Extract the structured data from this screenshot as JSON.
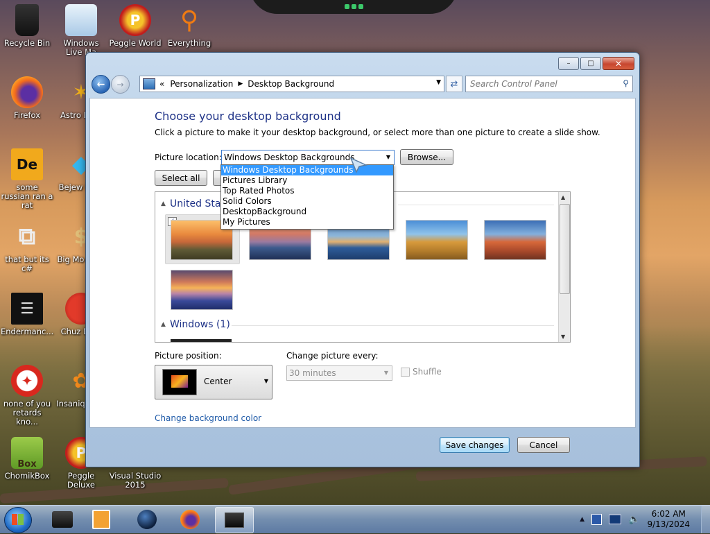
{
  "desktop": {
    "icons": [
      {
        "label": "Recycle Bin",
        "icon": "recycle-bin-icon"
      },
      {
        "label": "Windows Live Ma",
        "icon": "windows-live-mail-icon"
      },
      {
        "label": "Peggle World",
        "icon": "peggle-icon"
      },
      {
        "label": "Everything",
        "icon": "search-magnifier-icon"
      },
      {
        "label": "Firefox",
        "icon": "firefox-icon"
      },
      {
        "label": "Astro Delu",
        "icon": "astro-game-icon"
      },
      {
        "label": "some russian ran a rat",
        "icon": "de-app-icon"
      },
      {
        "label": "Bejew Delu",
        "icon": "gem-icon"
      },
      {
        "label": "that but its c#",
        "icon": "copy-windows-icon"
      },
      {
        "label": "Big Mo Delu",
        "icon": "money-bag-icon"
      },
      {
        "label": "Endermanc...",
        "icon": "console-icon"
      },
      {
        "label": "Chuz Delu",
        "icon": "chuzzle-icon"
      },
      {
        "label": "none of you retards kno...",
        "icon": "red-dino-icon"
      },
      {
        "label": "Insaniq Delu",
        "icon": "fish-icon"
      },
      {
        "label": "ChomikBox",
        "icon": "chomikbox-icon"
      },
      {
        "label": "Peggle Deluxe",
        "icon": "peggle-icon"
      },
      {
        "label": "Visual Studio 2015",
        "icon": "visual-studio-icon"
      }
    ]
  },
  "window": {
    "controls": {
      "minimize": "–",
      "maximize": "□",
      "close": "✕"
    },
    "nav": {
      "back": "←",
      "forward": "→"
    },
    "address": {
      "prefix": "«",
      "crumbs": [
        "Personalization",
        "Desktop Background"
      ]
    },
    "search_placeholder": "Search Control Panel",
    "title": "Choose your desktop background",
    "subtitle": "Click a picture to make it your desktop background, or select more than one picture to create a slide show.",
    "picture_location_label": "Picture location:",
    "picture_location_value": "Windows Desktop Backgrounds",
    "browse_label": "Browse...",
    "select_all_label": "Select all",
    "location_options": [
      "Windows Desktop Backgrounds",
      "Pictures Library",
      "Top Rated Photos",
      "Solid Colors",
      "DesktopBackground",
      "My Pictures"
    ],
    "gallery": {
      "group1": "United Stat",
      "group2": "Windows (1)"
    },
    "picture_position_label": "Picture position:",
    "picture_position_value": "Center",
    "change_every_label": "Change picture every:",
    "change_every_value": "30 minutes",
    "shuffle_label": "Shuffle",
    "bg_color_link": "Change background color",
    "save_label": "Save changes",
    "cancel_label": "Cancel"
  },
  "taskbar": {
    "time": "6:02 AM",
    "date": "9/13/2024",
    "tray_arrow": "▲"
  },
  "colors": {
    "accent": "#1e3287",
    "link": "#1e5aa8",
    "highlight": "#3399ff"
  }
}
